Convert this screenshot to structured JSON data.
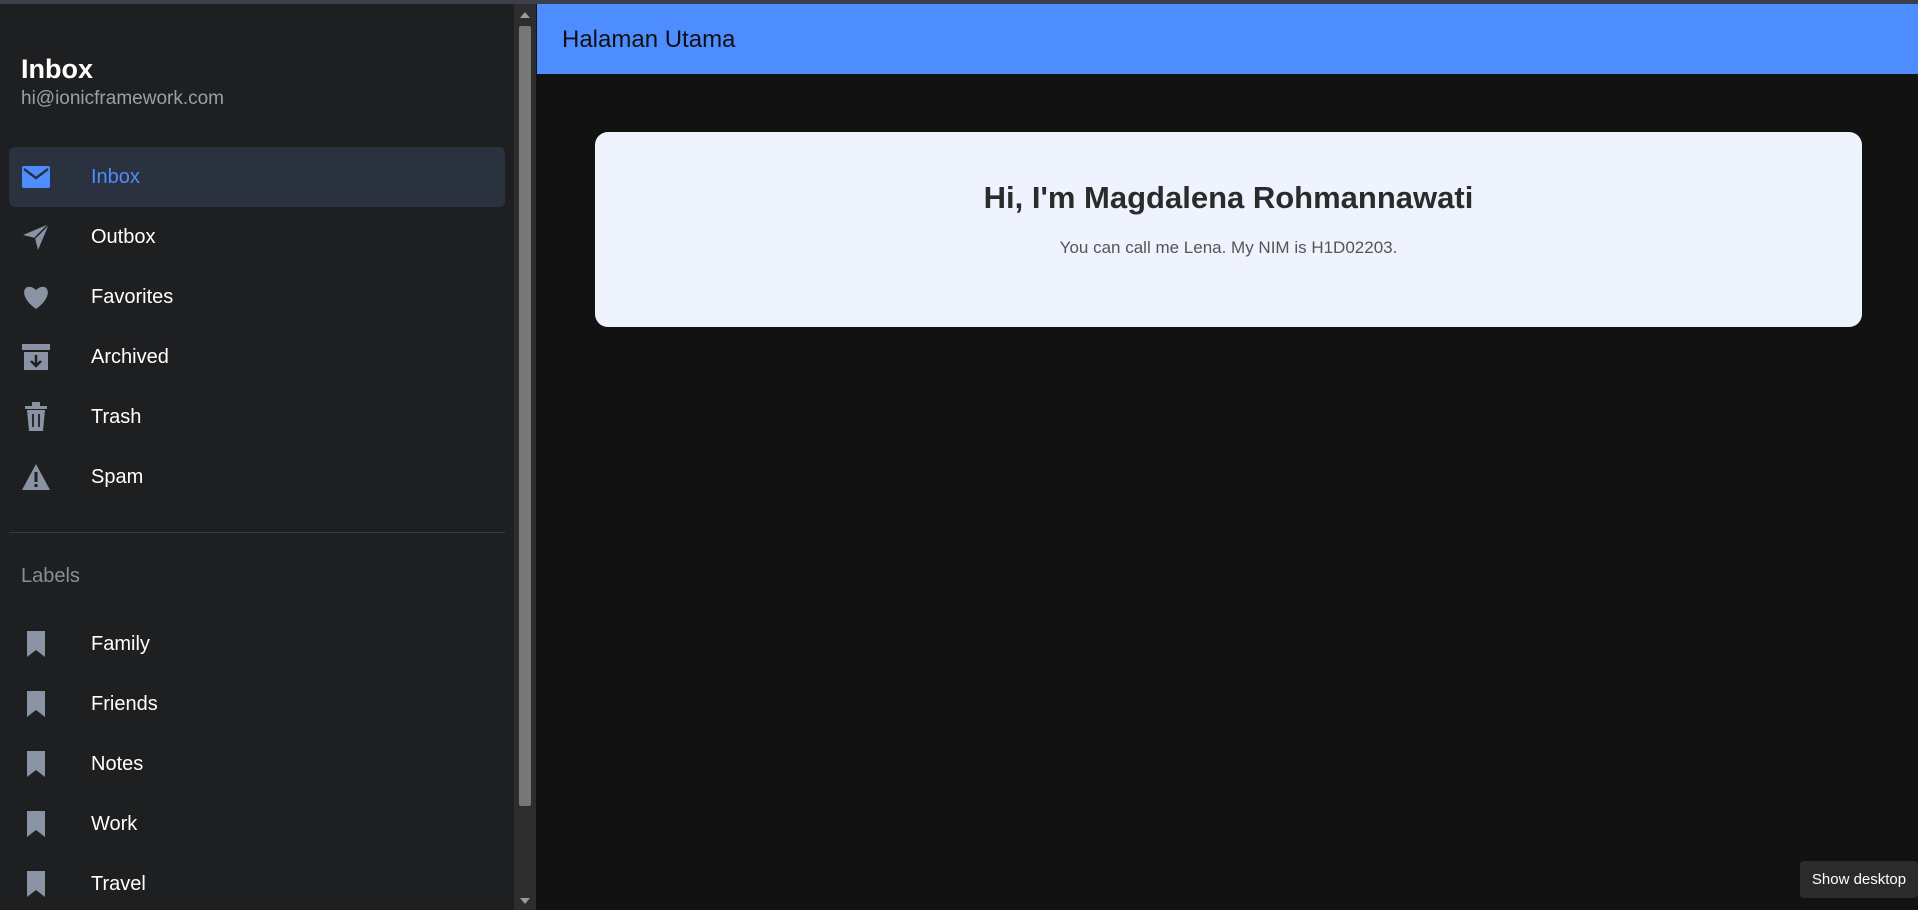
{
  "sidebar": {
    "title": "Inbox",
    "subtitle": "hi@ionicframework.com",
    "menu": [
      {
        "label": "Inbox",
        "icon": "mail-icon",
        "active": true
      },
      {
        "label": "Outbox",
        "icon": "paper-plane-icon"
      },
      {
        "label": "Favorites",
        "icon": "heart-icon"
      },
      {
        "label": "Archived",
        "icon": "archive-icon"
      },
      {
        "label": "Trash",
        "icon": "trash-icon"
      },
      {
        "label": "Spam",
        "icon": "warning-icon"
      }
    ],
    "labels_heading": "Labels",
    "labels": [
      {
        "label": "Family",
        "icon": "bookmark-icon"
      },
      {
        "label": "Friends",
        "icon": "bookmark-icon"
      },
      {
        "label": "Notes",
        "icon": "bookmark-icon"
      },
      {
        "label": "Work",
        "icon": "bookmark-icon"
      },
      {
        "label": "Travel",
        "icon": "bookmark-icon"
      }
    ]
  },
  "header": {
    "title": "Halaman Utama"
  },
  "card": {
    "title": "Hi, I'm Magdalena Rohmannawati",
    "text": "You can call me Lena. My NIM is H1D02203."
  },
  "tooltip": {
    "text": "Show desktop"
  },
  "colors": {
    "accent": "#4d8dff",
    "sidebar_bg": "#1e1f21",
    "content_bg": "#121212",
    "card_bg": "#eef3fd",
    "icon_gray": "#8a93a3"
  }
}
